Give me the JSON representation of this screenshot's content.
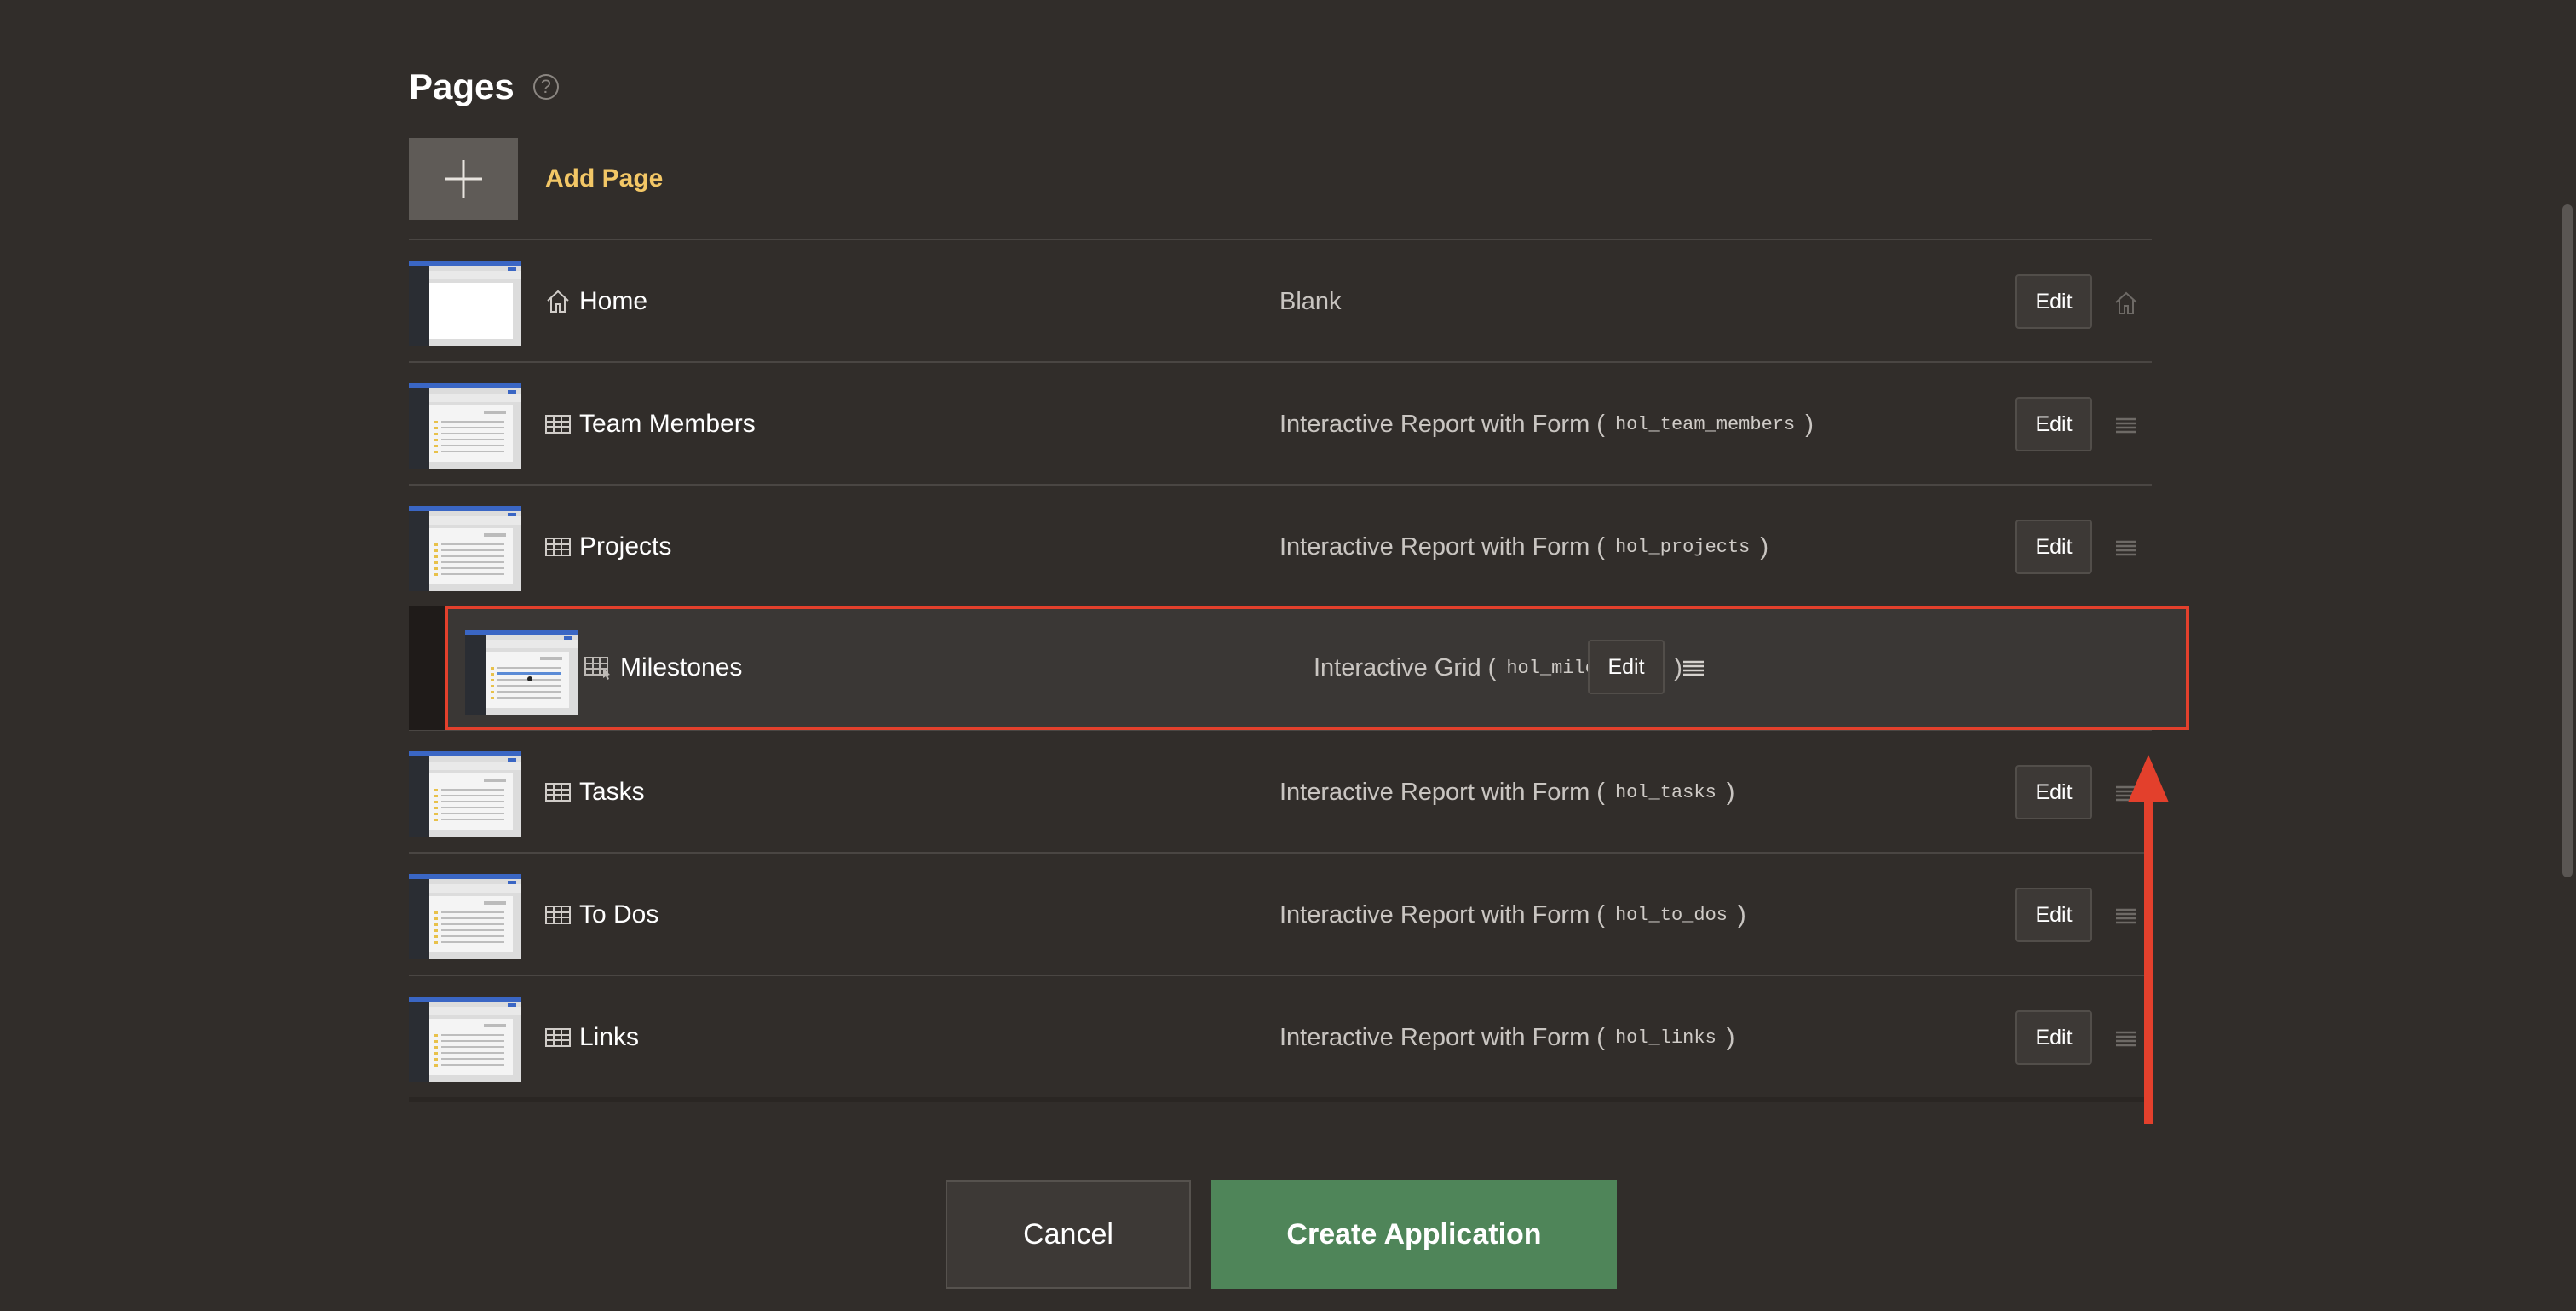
{
  "section": {
    "title": "Pages",
    "help_icon": "?"
  },
  "add_page": {
    "label": "Add Page"
  },
  "edit_label": "Edit",
  "rows": [
    {
      "name": "Home",
      "type": "Blank",
      "table": "",
      "icon": "home-icon",
      "right": "home"
    },
    {
      "name": "Team Members",
      "type": "Interactive Report with Form (",
      "table": "hol_team_members",
      "close": ")",
      "icon": "report-icon",
      "right": "handle"
    },
    {
      "name": "Projects",
      "type": "Interactive Report with Form (",
      "table": "hol_projects",
      "close": ")",
      "icon": "report-icon",
      "right": "handle"
    },
    {
      "name": "Tasks",
      "type": "Interactive Report with Form (",
      "table": "hol_tasks",
      "close": ")",
      "icon": "report-icon",
      "right": "handle"
    },
    {
      "name": "To Dos",
      "type": "Interactive Report with Form (",
      "table": "hol_to_dos",
      "close": ")",
      "icon": "report-icon",
      "right": "handle"
    },
    {
      "name": "Links",
      "type": "Interactive Report with Form (",
      "table": "hol_links",
      "close": ")",
      "icon": "report-icon",
      "right": "handle"
    }
  ],
  "dragging": {
    "name": "Milestones",
    "type": "Interactive Grid (",
    "table": "hol_milestones",
    "close": ")",
    "icon": "grid-icon"
  },
  "footer": {
    "cancel": "Cancel",
    "create": "Create Application"
  },
  "colors": {
    "highlight": "#e3402c",
    "add_page": "#f3c766",
    "create": "#4f8559"
  }
}
